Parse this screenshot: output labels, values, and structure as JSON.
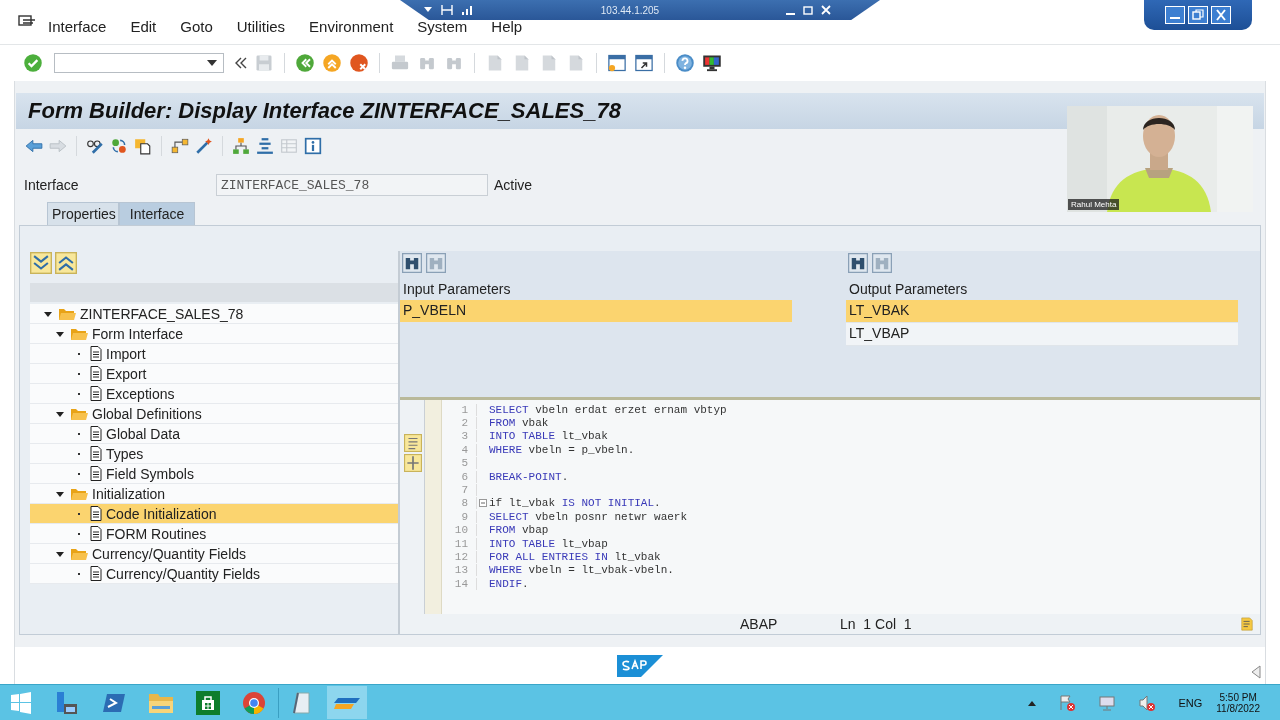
{
  "connection": {
    "address": "103.44.1.205"
  },
  "menu": [
    "Interface",
    "Edit",
    "Goto",
    "Utilities",
    "Environment",
    "System",
    "Help"
  ],
  "title": "Form Builder: Display Interface ZINTERFACE_SALES_78",
  "interface_field": {
    "label": "Interface",
    "value": "ZINTERFACE_SALES_78",
    "status": "Active"
  },
  "tabs": [
    {
      "label": "Properties",
      "selected": false
    },
    {
      "label": "Interface",
      "selected": true
    }
  ],
  "tree": [
    {
      "label": "ZINTERFACE_SALES_78",
      "kind": "folder",
      "expanded": true,
      "selected": false,
      "children": [
        {
          "label": "Form Interface",
          "kind": "folder",
          "expanded": true,
          "selected": false,
          "children": [
            {
              "label": "Import",
              "kind": "document",
              "selected": false
            },
            {
              "label": "Export",
              "kind": "document",
              "selected": false
            },
            {
              "label": "Exceptions",
              "kind": "document",
              "selected": false
            }
          ]
        },
        {
          "label": "Global Definitions",
          "kind": "folder",
          "expanded": true,
          "selected": false,
          "children": [
            {
              "label": "Global Data",
              "kind": "document",
              "selected": false
            },
            {
              "label": "Types",
              "kind": "document",
              "selected": false
            },
            {
              "label": "Field Symbols",
              "kind": "document",
              "selected": false
            }
          ]
        },
        {
          "label": "Initialization",
          "kind": "folder",
          "expanded": true,
          "selected": false,
          "children": [
            {
              "label": "Code Initialization",
              "kind": "document",
              "selected": true
            },
            {
              "label": "FORM Routines",
              "kind": "document",
              "selected": false
            }
          ]
        },
        {
          "label": "Currency/Quantity Fields",
          "kind": "folder",
          "expanded": true,
          "selected": false,
          "children": [
            {
              "label": "Currency/Quantity Fields",
              "kind": "document",
              "selected": false
            }
          ]
        }
      ]
    }
  ],
  "input_parameters": {
    "heading": "Input Parameters",
    "rows": [
      {
        "name": "P_VBELN",
        "selected": true
      }
    ]
  },
  "output_parameters": {
    "heading": "Output Parameters",
    "rows": [
      {
        "name": "LT_VBAK",
        "selected": true
      },
      {
        "name": "LT_VBAP",
        "selected": false
      }
    ]
  },
  "code": [
    {
      "number": "1",
      "fold": false,
      "tokens": [
        {
          "text": "SELECT",
          "kind": "keyword"
        },
        {
          "text": " vbeln erdat erzet ernam vbtyp",
          "kind": "text"
        }
      ]
    },
    {
      "number": "2",
      "fold": false,
      "tokens": [
        {
          "text": "FROM",
          "kind": "keyword"
        },
        {
          "text": " vbak",
          "kind": "text"
        }
      ]
    },
    {
      "number": "3",
      "fold": false,
      "tokens": [
        {
          "text": "INTO TABLE",
          "kind": "keyword"
        },
        {
          "text": " lt_vbak",
          "kind": "text"
        }
      ]
    },
    {
      "number": "4",
      "fold": false,
      "tokens": [
        {
          "text": "WHERE",
          "kind": "keyword"
        },
        {
          "text": " vbeln = p_vbeln.",
          "kind": "text"
        }
      ]
    },
    {
      "number": "5",
      "fold": false
    },
    {
      "number": "6",
      "fold": false,
      "tokens": [
        {
          "text": "BREAK-POINT",
          "kind": "keyword"
        },
        {
          "text": ".",
          "kind": "text"
        }
      ]
    },
    {
      "number": "7",
      "fold": false
    },
    {
      "number": "8",
      "fold": true,
      "tokens": [
        {
          "text": "if lt_vbak ",
          "kind": "text"
        },
        {
          "text": "IS NOT INITIAL",
          "kind": "keyword"
        },
        {
          "text": ".",
          "kind": "text"
        }
      ]
    },
    {
      "number": "9",
      "fold": false,
      "tokens": [
        {
          "text": "SELECT",
          "kind": "keyword"
        },
        {
          "text": " vbeln posnr netwr waerk",
          "kind": "text"
        }
      ]
    },
    {
      "number": "10",
      "fold": false,
      "tokens": [
        {
          "text": "FROM",
          "kind": "keyword"
        },
        {
          "text": " vbap",
          "kind": "text"
        }
      ]
    },
    {
      "number": "11",
      "fold": false,
      "tokens": [
        {
          "text": "INTO TABLE",
          "kind": "keyword"
        },
        {
          "text": " lt_vbap",
          "kind": "text"
        }
      ]
    },
    {
      "number": "12",
      "fold": false,
      "tokens": [
        {
          "text": "FOR ALL ENTRIES IN",
          "kind": "keyword"
        },
        {
          "text": " lt_vbak",
          "kind": "text"
        }
      ]
    },
    {
      "number": "13",
      "fold": false,
      "tokens": [
        {
          "text": "WHERE",
          "kind": "keyword"
        },
        {
          "text": " vbeln = lt_vbak-vbeln.",
          "kind": "text"
        }
      ]
    },
    {
      "number": "14",
      "fold": false,
      "tokens": [
        {
          "text": "ENDIF",
          "kind": "keyword"
        },
        {
          "text": ".",
          "kind": "text"
        }
      ]
    }
  ],
  "editor_status": {
    "language": "ABAP",
    "position": "Ln  1 Col  1"
  },
  "webcam": {
    "kind": "picture",
    "name": "Rahul Mehta"
  },
  "taskbar": {
    "language": "ENG",
    "time": "5:50 PM",
    "date": "11/8/2022"
  }
}
